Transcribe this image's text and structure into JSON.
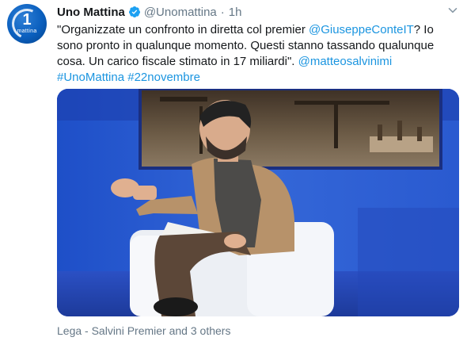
{
  "tweet": {
    "author_name": "Uno Mattina",
    "handle": "@Unomattina",
    "separator": "·",
    "time": "1h",
    "avatar": {
      "number": "1",
      "wordmark": "mattina"
    },
    "text": {
      "p1": "\"Organizzate un confronto in diretta col premier ",
      "mention1": "@GiuseppeConteIT",
      "p2": "? Io sono pronto in qualunque momento. Questi stanno tassando qualunque cosa. Un carico fiscale stimato in 17 miliardi\". ",
      "mention2": "@matteosalvinimi",
      "hashtag1": "#UnoMattina",
      "hashtag2": "#22novembre"
    },
    "media_alt": "Matteo Salvini seated in a white armchair in a TV studio",
    "footer": "Lega - Salvini Premier and 3 others"
  },
  "colors": {
    "text": "#14171a",
    "secondary": "#657786",
    "link": "#1b95e0",
    "verified": "#1da1f2"
  },
  "icons": {
    "verified": "verified-badge-icon",
    "more": "chevron-down-icon"
  }
}
